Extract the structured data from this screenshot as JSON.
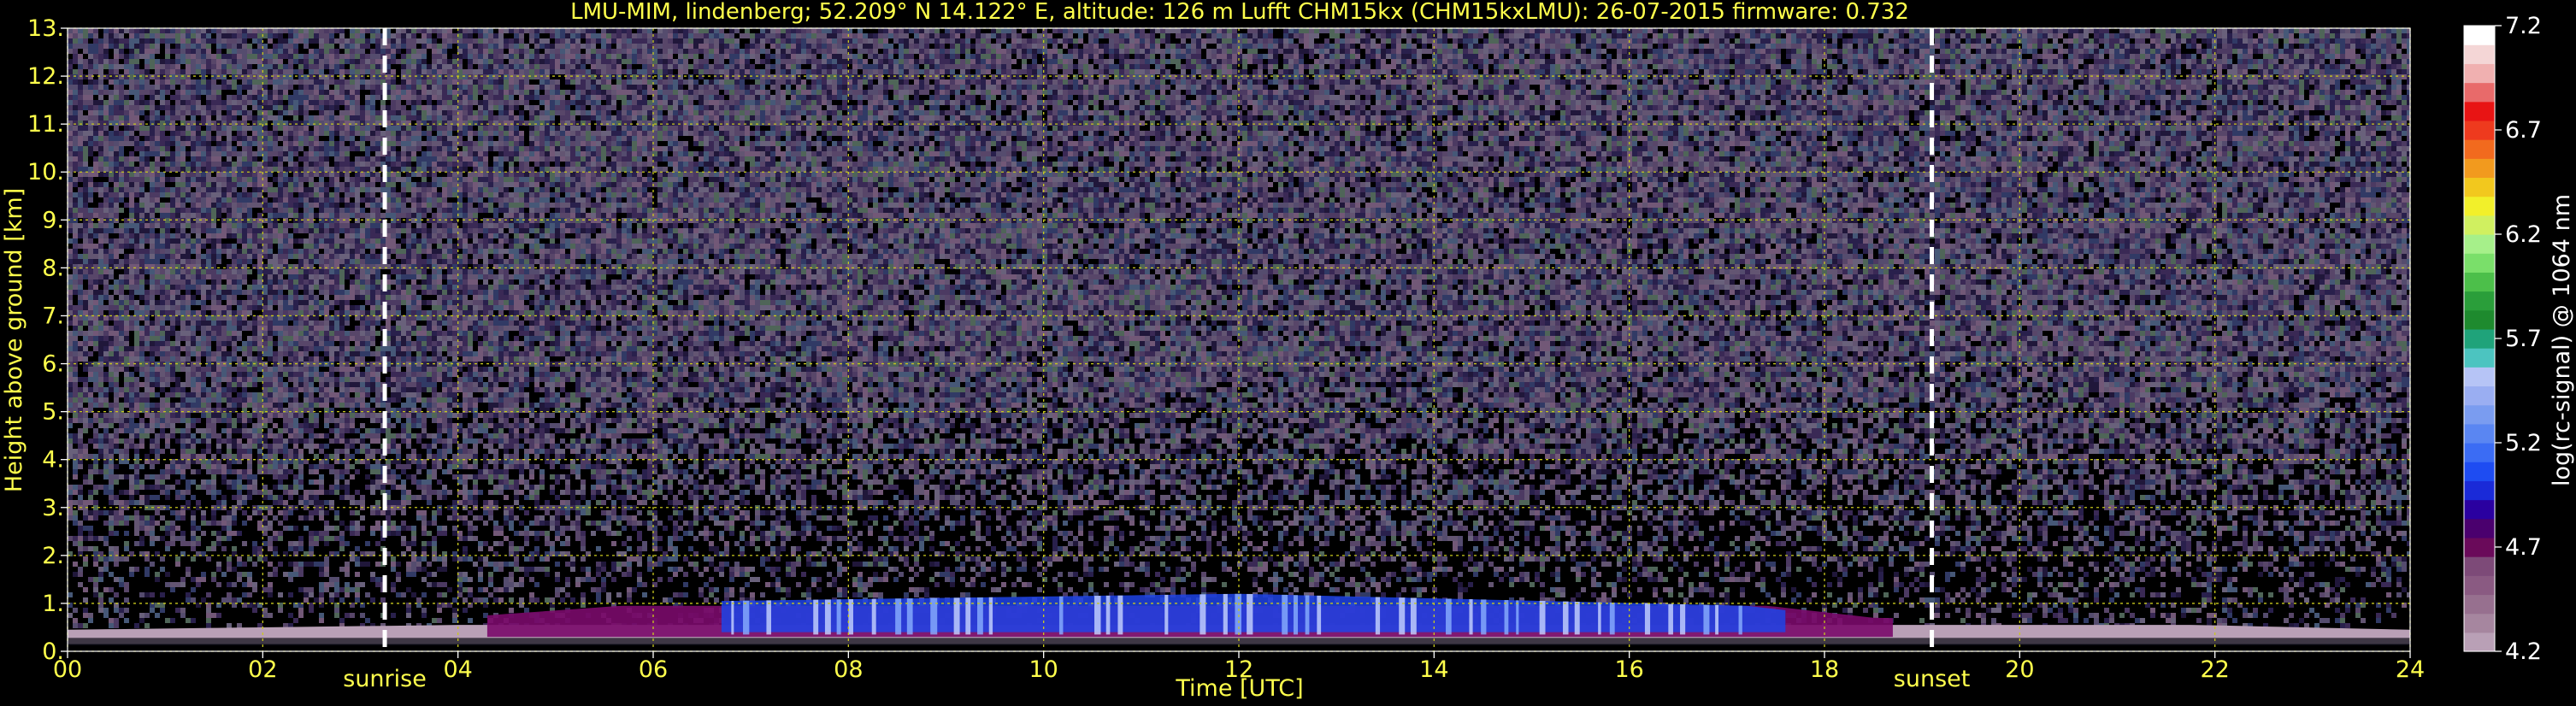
{
  "chart_data": {
    "type": "heatmap",
    "title": "LMU-MIM, lindenberg; 52.209° N 14.122° E, altitude: 126 m    Lufft CHM15kx (CHM15kxLMU): 26-07-2015    firmware: 0.732",
    "xlabel": "Time [UTC]",
    "ylabel": "Height above ground [km]",
    "xlim": [
      0,
      24
    ],
    "ylim": [
      0,
      13
    ],
    "x_ticks": [
      "00",
      "02",
      "04",
      "06",
      "08",
      "10",
      "12",
      "14",
      "16",
      "18",
      "20",
      "22",
      "24"
    ],
    "y_ticks": [
      "0.",
      "1.",
      "2.",
      "3.",
      "4.",
      "5.",
      "6.",
      "7.",
      "8.",
      "9.",
      "10.",
      "11.",
      "12.",
      "13."
    ],
    "grid": true,
    "annotations": [
      {
        "label": "sunrise",
        "x": 3.25
      },
      {
        "label": "sunset",
        "x": 19.1
      }
    ],
    "boundary_layer": [
      {
        "t": 0,
        "top": 0.45,
        "level": "light"
      },
      {
        "t": 4.0,
        "top": 0.55,
        "level": "light"
      },
      {
        "t": 4.3,
        "top": 0.75,
        "level": "medium"
      },
      {
        "t": 6.7,
        "top": 1.1,
        "level": "high"
      },
      {
        "t": 12.0,
        "top": 1.25,
        "level": "high"
      },
      {
        "t": 17.2,
        "top": 1.0,
        "level": "high"
      },
      {
        "t": 18.5,
        "top": 0.7,
        "level": "medium"
      },
      {
        "t": 24,
        "top": 0.45,
        "level": "light"
      }
    ],
    "colorbar": {
      "label": "log(rc-signal) @ 1064 nm",
      "min": 4.2,
      "max": 7.2,
      "ticks": [
        "4.2",
        "4.7",
        "5.2",
        "5.7",
        "6.2",
        "6.7",
        "7.2"
      ],
      "colors": [
        "#b9a0b6",
        "#a6869f",
        "#97708f",
        "#8a5a82",
        "#7d4a78",
        "#6a0a5a",
        "#4a006e",
        "#2a00a0",
        "#1a2ad8",
        "#1e4cf2",
        "#3b6cf4",
        "#5a86f2",
        "#7a9cf0",
        "#9aaef2",
        "#b6c4f6",
        "#4cc4c0",
        "#1fa37a",
        "#1e8a2e",
        "#2a9e3a",
        "#4cbf4a",
        "#7adf6a",
        "#a6f08a",
        "#d0f060",
        "#f2f02a",
        "#f2c81e",
        "#f29a1e",
        "#f26a1e",
        "#ee3a1e",
        "#e81414",
        "#e86a6a",
        "#f0b0b0",
        "#f4d6d6",
        "#ffffff"
      ]
    }
  },
  "colors": {
    "label": "#ffff4c",
    "grid": "#c8c81e",
    "background": "#000000",
    "noise": [
      "#6a4a9a",
      "#4a3a8a",
      "#8a6ab2",
      "#9a8ac8",
      "#5a6ab8",
      "#b49ad0",
      "#7fa0d8",
      "#c0b0e0",
      "#3a2a6a",
      "#a080c0",
      "#8fb8a0",
      "#d0a0d8"
    ]
  }
}
